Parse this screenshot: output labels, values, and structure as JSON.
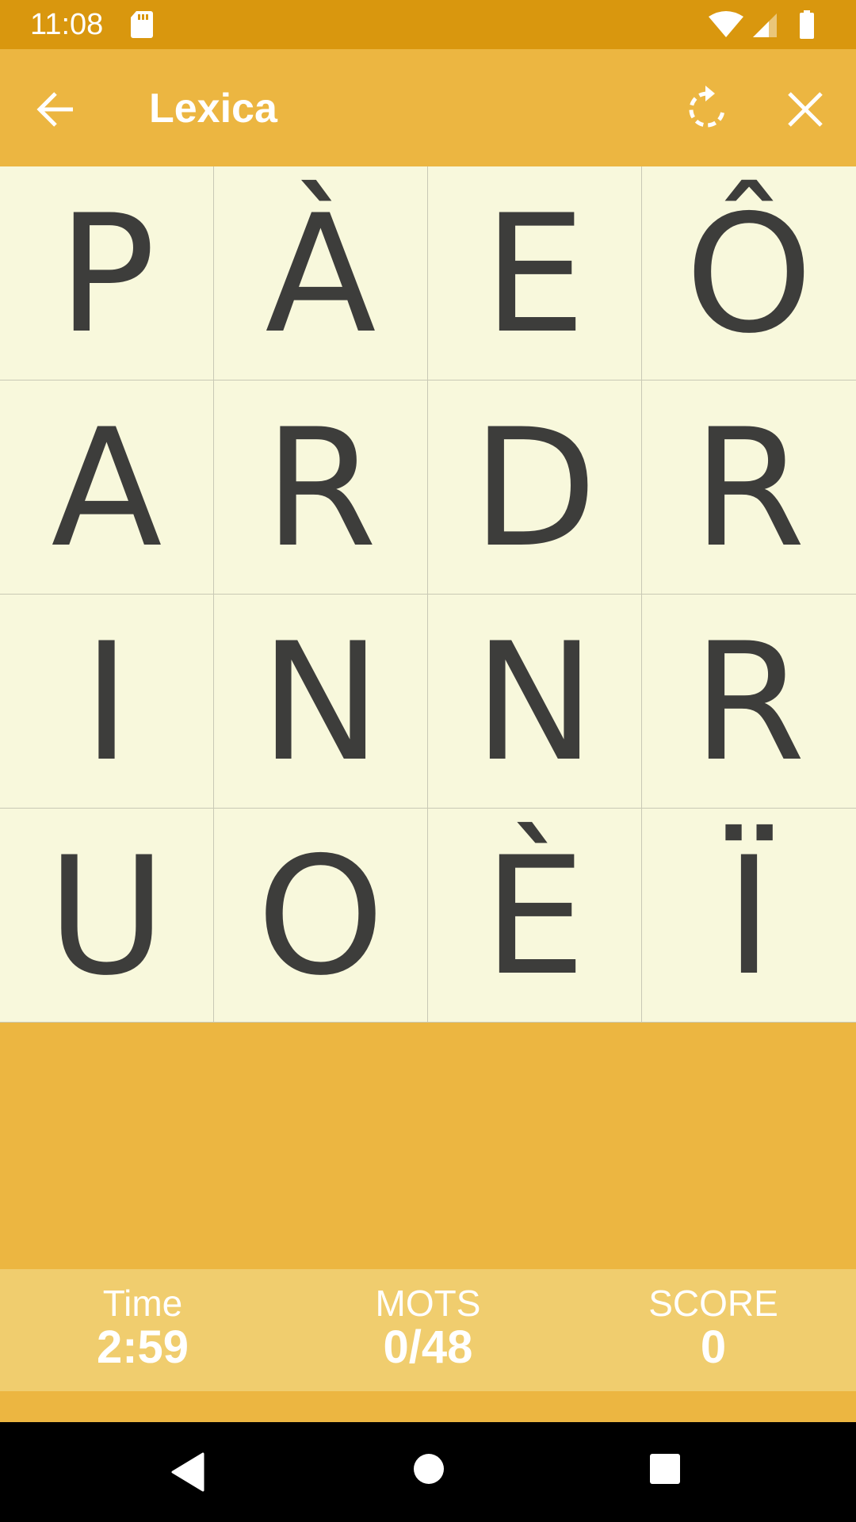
{
  "status_bar": {
    "time": "11:08",
    "icons": [
      "sd-card-icon",
      "wifi-icon",
      "signal-icon",
      "battery-icon"
    ]
  },
  "app_bar": {
    "title": "Lexica",
    "back_icon": "arrow-back-icon",
    "rotate_icon": "rotate-icon",
    "close_icon": "close-icon"
  },
  "board": {
    "rows": [
      [
        "P",
        "À",
        "E",
        "Ô"
      ],
      [
        "A",
        "R",
        "D",
        "R"
      ],
      [
        "I",
        "N",
        "N",
        "R"
      ],
      [
        "U",
        "O",
        "È",
        "Ï"
      ]
    ]
  },
  "stats": {
    "time_label": "Time",
    "time_value": "2:59",
    "words_label": "MOTS",
    "words_value": "0/48",
    "score_label": "SCORE",
    "score_value": "0"
  },
  "nav_bar": {
    "icons": [
      "nav-back-icon",
      "nav-home-icon",
      "nav-recents-icon"
    ]
  },
  "colors": {
    "status_bar": "#d9970e",
    "accent": "#ecb641",
    "board_bg": "#f8f8dc",
    "score_panel": "#f0cd6e",
    "letter": "#3d3d3b"
  }
}
